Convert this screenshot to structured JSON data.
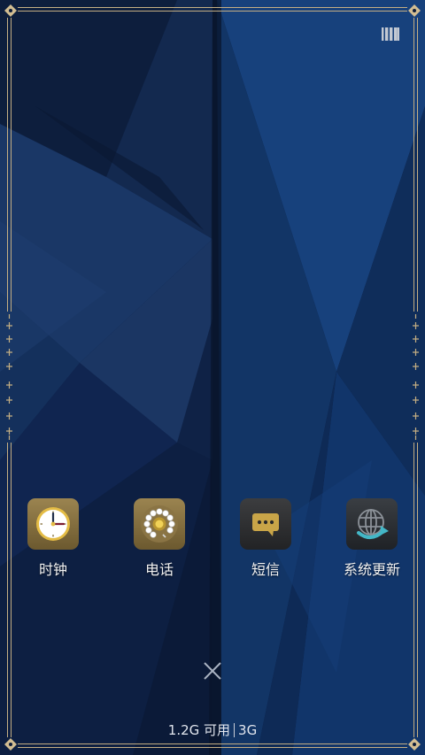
{
  "colors": {
    "wallpaper_base": "#0c1c3a",
    "frame_gold": "#c4ae83",
    "label_text": "#f1f1f1",
    "update_arrow": "#43b7c7"
  },
  "top_right_icon": "menu-bars-icon",
  "apps": [
    {
      "label": "时钟",
      "icon": "clock-icon"
    },
    {
      "label": "电话",
      "icon": "rotary-phone-icon"
    },
    {
      "label": "短信",
      "icon": "message-icon"
    },
    {
      "label": "系统更新",
      "icon": "system-update-icon"
    }
  ],
  "close_icon": "close-icon",
  "memory": {
    "available": "1.2G 可用",
    "network": "3G"
  }
}
